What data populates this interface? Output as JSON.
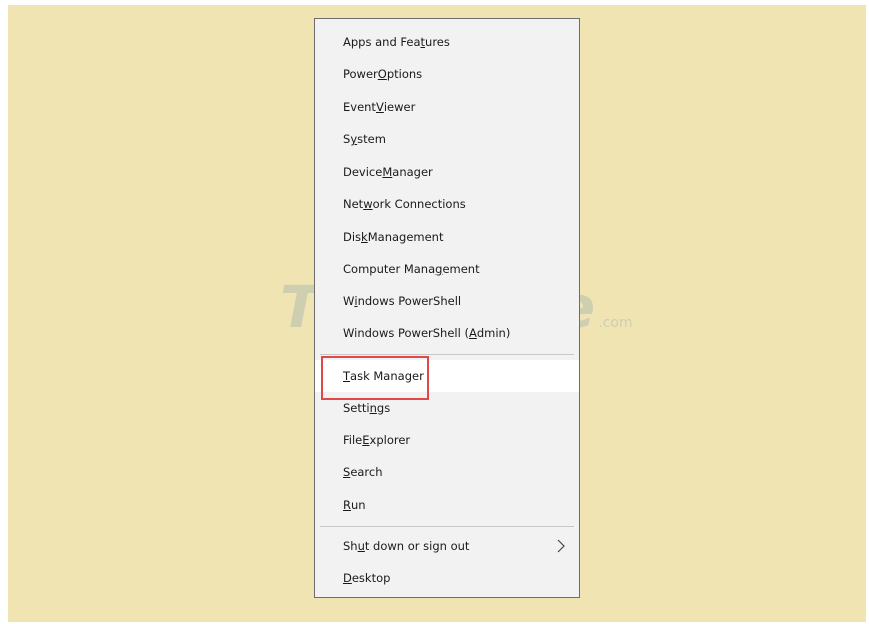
{
  "watermark": {
    "text": "TipsMake",
    "suffix": ".com"
  },
  "menu": {
    "items": [
      {
        "pre": "Apps and Fea",
        "key": "t",
        "post": "ures"
      },
      {
        "pre": "Power ",
        "key": "O",
        "post": "ptions"
      },
      {
        "pre": "Event ",
        "key": "V",
        "post": "iewer"
      },
      {
        "pre": "S",
        "key": "y",
        "post": "stem"
      },
      {
        "pre": "Device ",
        "key": "M",
        "post": "anager"
      },
      {
        "pre": "Net",
        "key": "w",
        "post": "ork Connections"
      },
      {
        "pre": "Dis",
        "key": "k",
        "post": " Management"
      },
      {
        "pre": "Computer Mana",
        "key": "g",
        "post": "ement"
      },
      {
        "pre": "W",
        "key": "i",
        "post": "ndows PowerShell"
      },
      {
        "pre": "Windows PowerShell (",
        "key": "A",
        "post": "dmin)"
      },
      {
        "pre": "",
        "key": "T",
        "post": "ask Manager"
      },
      {
        "pre": "Setti",
        "key": "n",
        "post": "gs"
      },
      {
        "pre": "File ",
        "key": "E",
        "post": "xplorer"
      },
      {
        "pre": "",
        "key": "S",
        "post": "earch"
      },
      {
        "pre": "",
        "key": "R",
        "post": "un"
      },
      {
        "pre": "Sh",
        "key": "u",
        "post": "t down or sign out"
      },
      {
        "pre": "",
        "key": "D",
        "post": "esktop"
      }
    ]
  },
  "colors": {
    "background": "#f0e4b3",
    "menu_bg": "#f2f2f2",
    "highlight": "#e04848"
  }
}
